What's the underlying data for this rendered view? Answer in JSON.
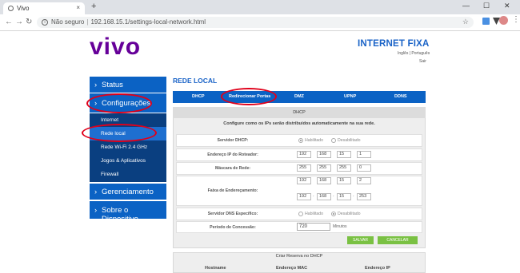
{
  "browser": {
    "tab_title": "Vivo",
    "tab_close": "×",
    "new_tab": "+",
    "window_controls": [
      "—",
      "☐",
      "✕"
    ],
    "not_secure": "Não seguro",
    "url": "192.168.15.1/settings-local-network.html",
    "icons": [
      "back-icon",
      "forward-icon",
      "reload-icon",
      "info-icon",
      "star-icon"
    ]
  },
  "header": {
    "logo": "vivo",
    "brand": "INTERNET FIXA",
    "lang_links": "Inglês | Português",
    "logout": "Sair",
    "colors": {
      "brand_blue": "#1a63c7",
      "logo_purple": "#660099"
    }
  },
  "sidebar": {
    "chevron": "›",
    "status": "Status",
    "config": "Configurações",
    "sub": [
      "Internet",
      "Rede local",
      "Rede Wi-Fi 2.4 GHz",
      "Jogos & Aplicativos",
      "Firewall"
    ],
    "management": "Gerenciamento",
    "about": "Sobre o Dispositivo"
  },
  "main": {
    "heading": "REDE LOCAL",
    "tabs": [
      "DHCP",
      "Redirecionar Portas",
      "DMZ",
      "UPNP",
      "DDNS"
    ],
    "panel_title": "DHCP",
    "description": "Configure como os IPs serão distribuídos automaticamente na sua rede.",
    "dhcp_server": {
      "label": "Servidor DHCP:",
      "on": "Habilitado",
      "off": "Desabilitado",
      "selected": "Habilitado"
    },
    "router_ip": {
      "label": "Endereço IP do Roteador:",
      "octets": [
        "192",
        "168",
        "15",
        "1"
      ]
    },
    "mask": {
      "label": "Máscara de Rede:",
      "octets": [
        "255",
        "255",
        "255",
        "0"
      ]
    },
    "range": {
      "label": "Faixa de Endereçamento:",
      "start": [
        "192",
        "168",
        "15",
        "2"
      ],
      "end": [
        "192",
        "168",
        "15",
        "253"
      ]
    },
    "dns": {
      "label": "Servidor DNS Específico:",
      "on": "Habilitado",
      "off": "Desabilitado",
      "selected": "Desabilitado"
    },
    "lease": {
      "label": "Período de Concessão:",
      "value": "720",
      "unit": "Minutos"
    },
    "save": "SALVAR",
    "cancel": "CANCELAR",
    "reserve_title": "Criar Reserva no DHCP",
    "reserve_cols": [
      "Hostname",
      "Endereço MAC",
      "Endereço IP"
    ],
    "button_color": "#7ac143"
  },
  "annotations": {
    "color": "#e0001a",
    "count": 3
  }
}
